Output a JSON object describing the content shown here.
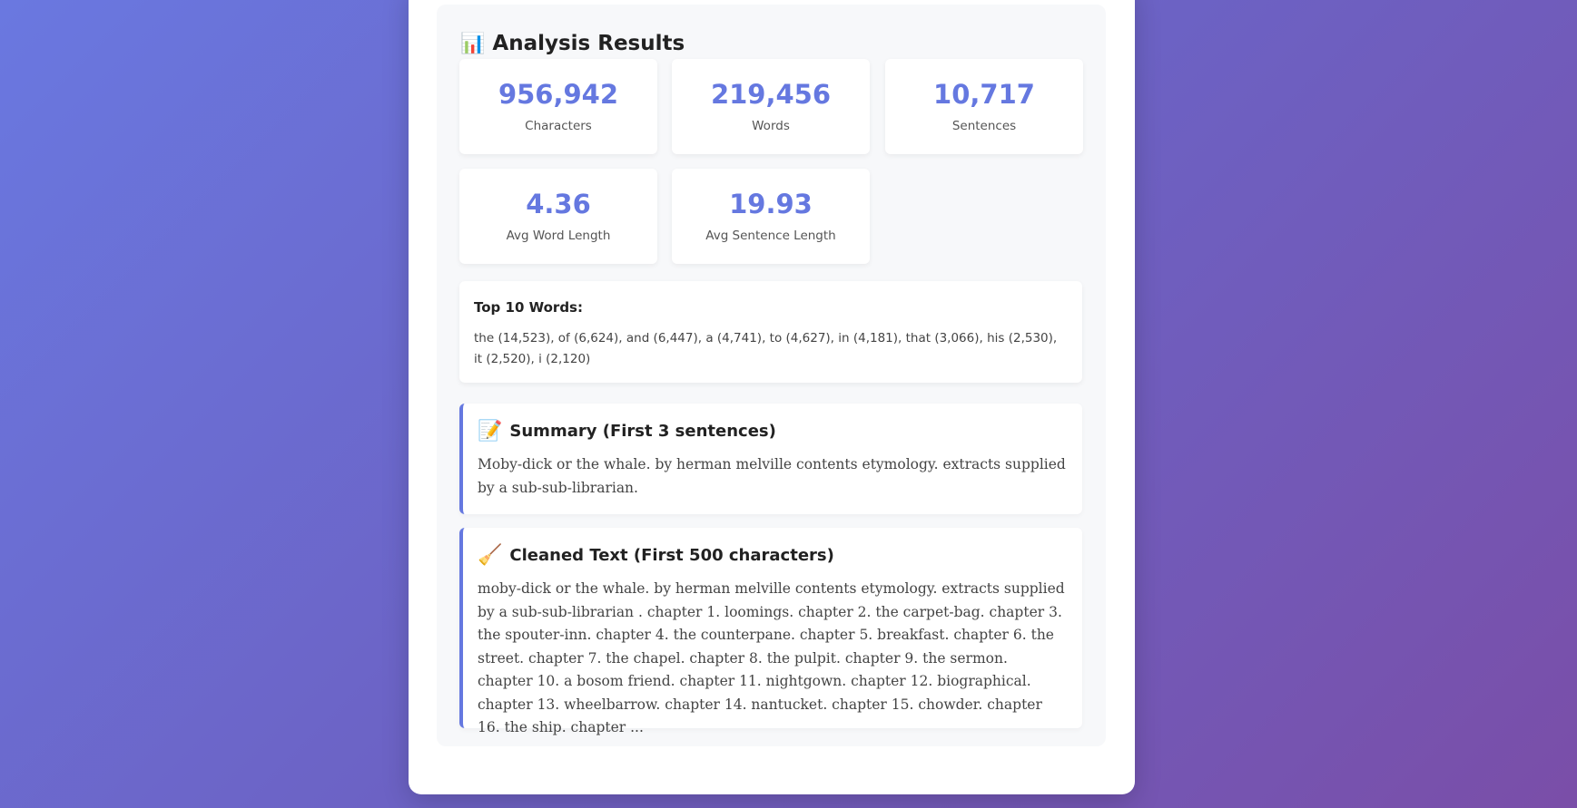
{
  "results": {
    "title": "Analysis Results",
    "title_icon": "📊",
    "stats": [
      {
        "value": "956,942",
        "label": "Characters"
      },
      {
        "value": "219,456",
        "label": "Words"
      },
      {
        "value": "10,717",
        "label": "Sentences"
      },
      {
        "value": "4.36",
        "label": "Avg Word Length"
      },
      {
        "value": "19.93",
        "label": "Avg Sentence Length"
      }
    ],
    "top_words": {
      "title": "Top 10 Words:",
      "text": "the (14,523), of (6,624), and (6,447), a (4,741), to (4,627), in (4,181), that (3,066), his (2,530), it (2,520), i (2,120)"
    },
    "summary": {
      "icon": "📝",
      "title": "Summary (First 3 sentences)",
      "text": "Moby-dick or the whale. by herman melville contents etymology. extracts supplied by a sub-sub-librarian."
    },
    "cleaned": {
      "icon": "🧹",
      "title": "Cleaned Text (First 500 characters)",
      "text": "moby-dick or the whale. by herman melville contents etymology. extracts supplied by a sub-sub-librarian . chapter 1. loomings. chapter 2. the carpet-bag. chapter 3. the spouter-inn. chapter 4. the counterpane. chapter 5. breakfast. chapter 6. the street. chapter 7. the chapel. chapter 8. the pulpit. chapter 9. the sermon. chapter 10. a bosom friend. chapter 11. nightgown. chapter 12. biographical. chapter 13. wheelbarrow. chapter 14. nantucket. chapter 15. chowder. chapter 16. the ship. chapter ..."
    }
  },
  "colors": {
    "accent": "#6578e0",
    "background_start": "#6a78e0",
    "background_end": "#7a4ea8"
  }
}
